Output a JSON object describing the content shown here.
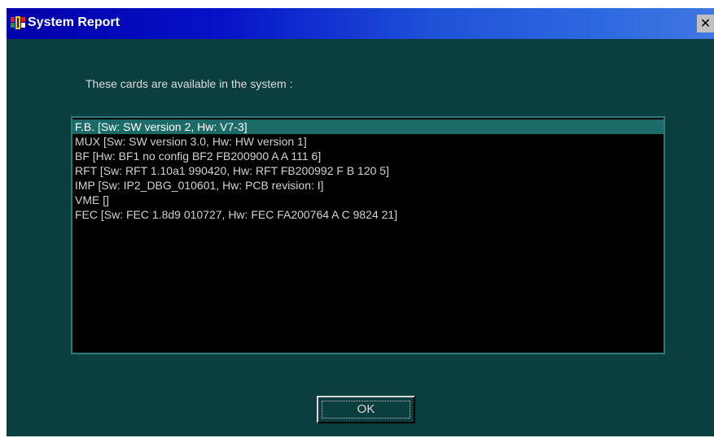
{
  "window": {
    "title": "System Report",
    "app_icon": "card-chip-icon",
    "close_glyph": "✕",
    "close_icon": "close-icon"
  },
  "prompt": "These cards are available in the system :",
  "cards": [
    "F.B. [Sw: SW version 2, Hw: V7-3]",
    "MUX [Sw: SW version 3.0, Hw: HW version 1]",
    "BF [Hw: BF1 no config BF2 FB200900 A A 111 6]",
    "RFT [Sw: RFT 1.10a1 990420, Hw: RFT FB200992 F B 120 5]",
    "IMP [Sw: IP2_DBG_010601, Hw: PCB revision: I]",
    "VME []",
    "FEC [Sw: FEC 1.8d9 010727, Hw: FEC FA200764 A C 9824 21]"
  ],
  "selected_index": 0,
  "ok_label": "OK",
  "colors": {
    "window_bg": "#0b3f3f",
    "title_gradient_start": "#0000a8",
    "title_gradient_end": "#4078e0",
    "selection": "#1d6b68",
    "list_bg": "#000000"
  }
}
